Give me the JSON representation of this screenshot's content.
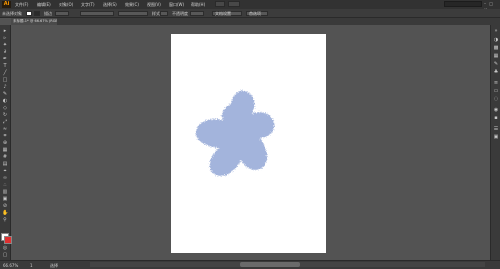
{
  "app": {
    "logo": "Ai"
  },
  "menubar": {
    "items": [
      "文件(F)",
      "编辑(E)",
      "对象(O)",
      "文字(T)",
      "选择(S)",
      "效果(C)",
      "视图(V)",
      "窗口(W)",
      "帮助(H)"
    ],
    "search_placeholder": "",
    "window_controls": "– □ ✕"
  },
  "controlbar": {
    "selection_label": "未选择对象",
    "stroke_label": "描边",
    "style_label": "样式",
    "opacity_label": "不透明度",
    "doc_setup_label": "文档设置",
    "prefs_label": "首选项"
  },
  "document": {
    "tab_label": "未标题-1* @ 66.67% (RGB/预览)"
  },
  "canvas": {
    "shape_color": "#a3b4dc"
  },
  "statusbar": {
    "zoom": "66.67%",
    "page": "1",
    "mode": "选择"
  },
  "tools": [
    "selection-tool",
    "direct-selection-tool",
    "magic-wand-tool",
    "lasso-tool",
    "pen-tool",
    "type-tool",
    "line-tool",
    "rectangle-tool",
    "paintbrush-tool",
    "pencil-tool",
    "blob-brush-tool",
    "eraser-tool",
    "rotate-tool",
    "scale-tool",
    "width-tool",
    "free-transform-tool",
    "shape-builder-tool",
    "perspective-grid-tool",
    "mesh-tool",
    "gradient-tool",
    "eyedropper-tool",
    "blend-tool",
    "symbol-sprayer-tool",
    "column-graph-tool",
    "artboard-tool",
    "slice-tool",
    "hand-tool",
    "zoom-tool"
  ]
}
